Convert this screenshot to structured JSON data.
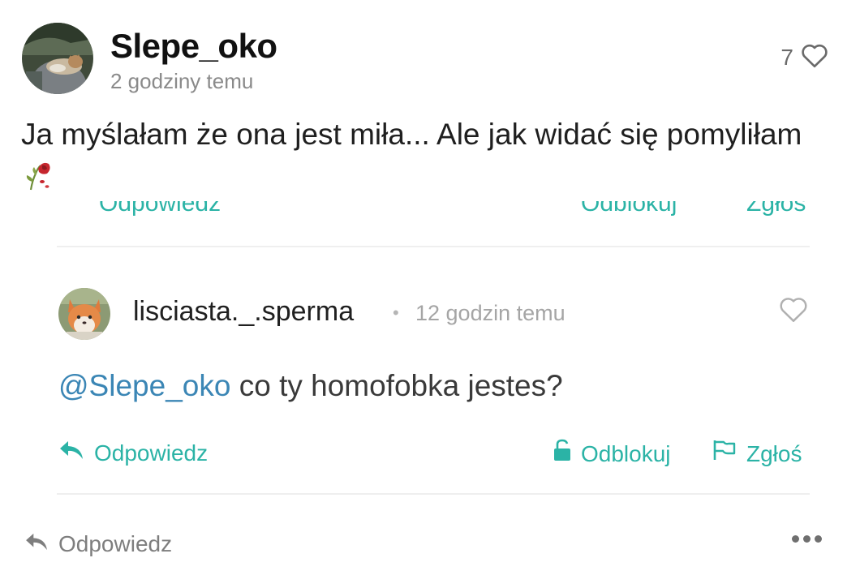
{
  "post": {
    "author": "Slepe_oko",
    "time": "2 godziny temu",
    "likes": "7",
    "text": "Ja myślałam że ona jest miła... Ale jak widać się pomyliłam",
    "emoji_icon": "wilted-rose-icon"
  },
  "previous_comment_actions": {
    "reply_label": "Odpowiedz",
    "unblock_label": "Odblokuj",
    "report_label": "Zgłoś"
  },
  "comment": {
    "author": "lisciasta._.sperma",
    "separator": "•",
    "time": "12 godzin temu",
    "mention": "@Slepe_oko",
    "text": " co ty homofobka jestes?",
    "reply_label": "Odpowiedz",
    "unblock_label": "Odblokuj",
    "report_label": "Zgłoś"
  },
  "footer": {
    "reply_label": "Odpowiedz"
  },
  "colors": {
    "accent": "#2bb3a6",
    "mention": "#3b86b5",
    "muted": "#8a8a8a"
  }
}
